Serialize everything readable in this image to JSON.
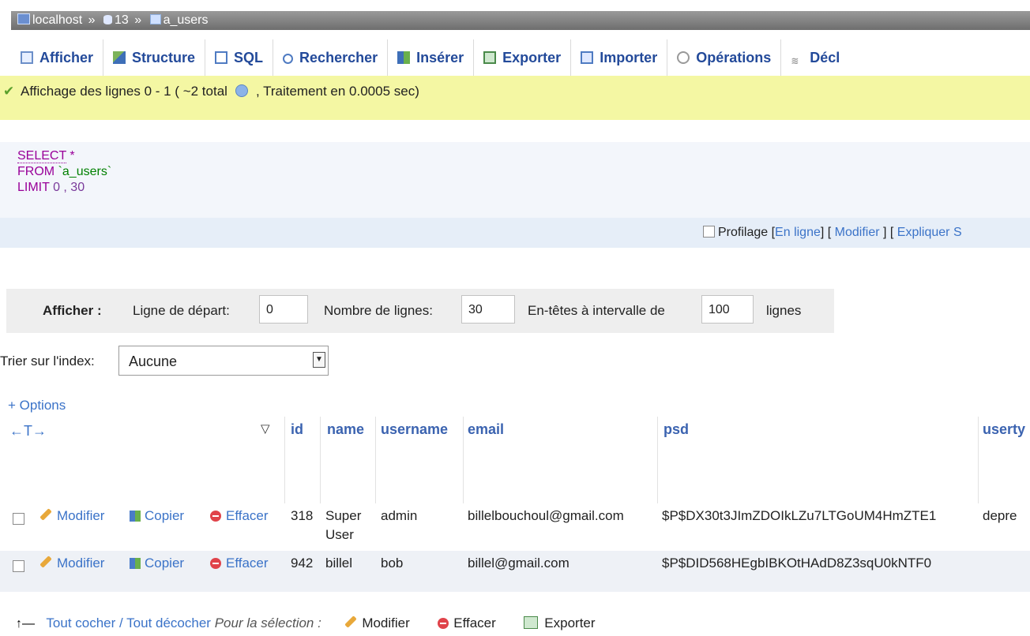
{
  "breadcrumb": {
    "server": "localhost",
    "database": "13",
    "table": "a_users",
    "separator": "»"
  },
  "tabs": [
    {
      "label": "Afficher",
      "icon": "browse-icon"
    },
    {
      "label": "Structure",
      "icon": "structure-icon"
    },
    {
      "label": "SQL",
      "icon": "sql-icon"
    },
    {
      "label": "Rechercher",
      "icon": "search-icon"
    },
    {
      "label": "Insérer",
      "icon": "insert-icon"
    },
    {
      "label": "Exporter",
      "icon": "export-icon"
    },
    {
      "label": "Importer",
      "icon": "import-icon"
    },
    {
      "label": "Opérations",
      "icon": "operations-icon"
    },
    {
      "label": "Décl",
      "icon": "triggers-icon"
    }
  ],
  "success": {
    "text_before": "Affichage des lignes 0 - 1 ( ~2 total",
    "text_after": ", Traitement en 0.0005 sec)"
  },
  "sql": {
    "select": "SELECT",
    "star": "*",
    "from": "FROM",
    "table": "`a_users`",
    "limit": "LIMIT",
    "limit_vals": "0 , 30"
  },
  "profiling": {
    "label": "Profilage",
    "inline": "En ligne",
    "edit": "Modifier",
    "explain": "Expliquer S"
  },
  "nav": {
    "show_label": "Afficher :",
    "start_label": "Ligne de départ:",
    "start_value": "0",
    "rows_label": "Nombre de lignes:",
    "rows_value": "30",
    "headers_label": "En-têtes à intervalle de",
    "headers_value": "100",
    "lines_label": "lignes"
  },
  "sort": {
    "label": "Trier sur l'index:",
    "selected": "Aucune"
  },
  "options_label": "+ Options",
  "arrows_label": "←T→",
  "columns": [
    "id",
    "name",
    "username",
    "email",
    "psd",
    "userty"
  ],
  "actions": {
    "edit": "Modifier",
    "copy": "Copier",
    "delete": "Effacer"
  },
  "rows": [
    {
      "id": "318",
      "name_line1": "Super",
      "name_line2": "User",
      "username": "admin",
      "email": "billelbouchoul@gmail.com",
      "psd": "$P$DX30t3JImZDOIkLZu7LTGoUM4HmZTE1",
      "usertype": "depre"
    },
    {
      "id": "942",
      "name_line1": "billel",
      "name_line2": "",
      "username": "bob",
      "email": "billel@gmail.com",
      "psd": "$P$DID568HEgbIBKOtHAdD8Z3sqU0kNTF0",
      "usertype": ""
    }
  ],
  "footer": {
    "check_all": "Tout cocher / Tout décocher",
    "for_selection": "Pour la sélection :",
    "edit": "Modifier",
    "delete": "Effacer",
    "export": "Exporter"
  }
}
